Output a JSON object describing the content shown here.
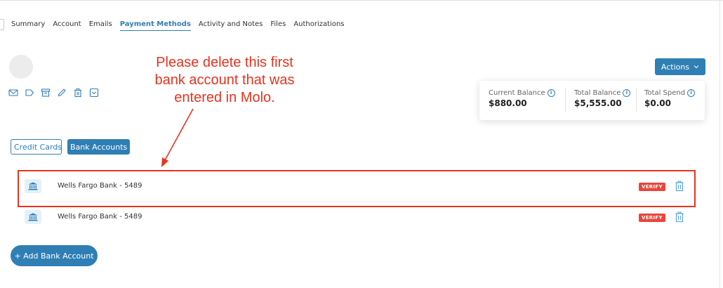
{
  "tabs": [
    {
      "label": "Summary",
      "active": false
    },
    {
      "label": "Account",
      "active": false
    },
    {
      "label": "Emails",
      "active": false
    },
    {
      "label": "Payment Methods",
      "active": true
    },
    {
      "label": "Activity and Notes",
      "active": false
    },
    {
      "label": "Files",
      "active": false
    },
    {
      "label": "Authorizations",
      "active": false
    }
  ],
  "toolbar_icons": [
    "mail-icon",
    "tag-icon",
    "archive-icon",
    "pencil-icon",
    "trash-icon",
    "dropdown-box-icon"
  ],
  "annotation": {
    "text": "Please delete this first bank account that was entered in Molo.",
    "color": "#e8331e"
  },
  "actions": {
    "label": "Actions"
  },
  "balances": [
    {
      "label": "Current Balance",
      "value": "$880.00"
    },
    {
      "label": "Total Balance",
      "value": "$5,555.00"
    },
    {
      "label": "Total Spend",
      "value": "$0.00"
    }
  ],
  "payment_type_tabs": {
    "credit_cards": "Credit Cards",
    "bank_accounts": "Bank Accounts"
  },
  "bank_accounts": [
    {
      "name": "Wells Fargo Bank - 5489",
      "badge": "VERIFY",
      "highlighted": true
    },
    {
      "name": "Wells Fargo Bank - 5489",
      "badge": "VERIFY",
      "highlighted": false
    }
  ],
  "add_button": {
    "label": "+ Add Bank Account"
  },
  "colors": {
    "accent": "#2f7fb5",
    "danger": "#e8453c",
    "annotation": "#e8331e"
  }
}
